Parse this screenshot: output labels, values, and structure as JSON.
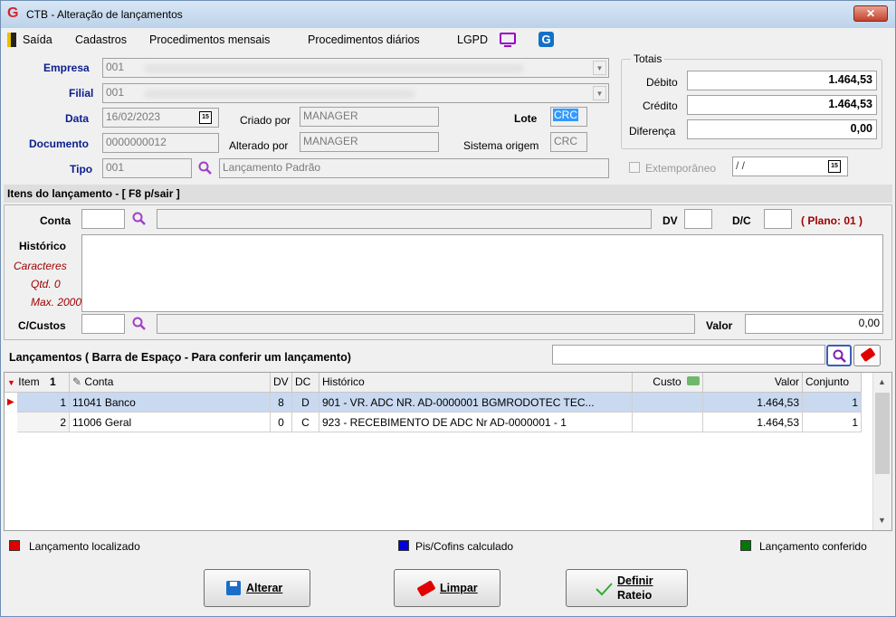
{
  "window": {
    "title": "CTB - Alteração de lançamentos",
    "close": "✕"
  },
  "menu": {
    "saida": "Saída",
    "cadastros": "Cadastros",
    "proc_mensais": "Procedimentos mensais",
    "proc_diarios": "Procedimentos diários",
    "lgpd": "LGPD"
  },
  "header": {
    "empresa_label": "Empresa",
    "empresa_value": "001",
    "filial_label": "Filial",
    "filial_value": "001",
    "data_label": "Data",
    "data_value": "16/02/2023",
    "criado_label": "Criado por",
    "criado_value": "MANAGER",
    "lote_label": "Lote",
    "lote_value": "CRC",
    "documento_label": "Documento",
    "documento_value": "0000000012",
    "alterado_label": "Alterado por",
    "alterado_value": "MANAGER",
    "sistema_label": "Sistema origem",
    "sistema_value": "CRC",
    "tipo_label": "Tipo",
    "tipo_value": "001",
    "tipo_desc": "Lançamento Padrão",
    "cal_icon": "15"
  },
  "totais": {
    "title": "Totais",
    "debito_label": "Débito",
    "debito_value": "1.464,53",
    "credito_label": "Crédito",
    "credito_value": "1.464,53",
    "diferenca_label": "Diferença",
    "diferenca_value": "0,00",
    "extemporaneo_label": "Extemporâneo",
    "extemporaneo_date": " / /"
  },
  "itens": {
    "bar_title": "Itens do lançamento - [ F8 p/sair ]",
    "conta_label": "Conta",
    "dv_label": "DV",
    "dc_label": "D/C",
    "plano": "( Plano: 01 )",
    "historico_label": "Histórico",
    "caracteres": "Caracteres",
    "qtd": "Qtd. 0",
    "max": "Max. 2000",
    "ccustos_label": "C/Custos",
    "valor_label": "Valor",
    "valor_value": "0,00"
  },
  "lancamentos": {
    "bar_title": "Lançamentos ( Barra de Espaço - Para conferir um lançamento)",
    "columns": {
      "item": "Item",
      "conta": "Conta",
      "dv": "DV",
      "dc": "DC",
      "historico": "Histórico",
      "custo": "Custo",
      "valor": "Valor",
      "conjunto": "Conjunto"
    },
    "rows": [
      {
        "item": "1",
        "conta": "11041 Banco",
        "dv": "8",
        "dc": "D",
        "historico": "901 - VR. ADC NR. AD-0000001 BGMRODOTEC TEC...",
        "custo": "",
        "valor": "1.464,53",
        "conjunto": "1"
      },
      {
        "item": "2",
        "conta": "11006 Geral",
        "dv": "0",
        "dc": "C",
        "historico": "923 - RECEBIMENTO DE ADC Nr AD-0000001 - 1",
        "custo": "",
        "valor": "1.464,53",
        "conjunto": "1"
      }
    ]
  },
  "legend": {
    "localizado": "Lançamento localizado",
    "piscofins": "Pis/Cofins calculado",
    "conferido": "Lançamento conferido"
  },
  "buttons": {
    "alterar": "Alterar",
    "limpar": "Limpar",
    "definir_line1": "Definir",
    "definir_line2": "Rateio"
  },
  "colors": {
    "red": "#e00000",
    "blue": "#0000e0",
    "green": "#007a00",
    "label_blue": "#0a1e8c",
    "plano_red": "#a00000"
  }
}
